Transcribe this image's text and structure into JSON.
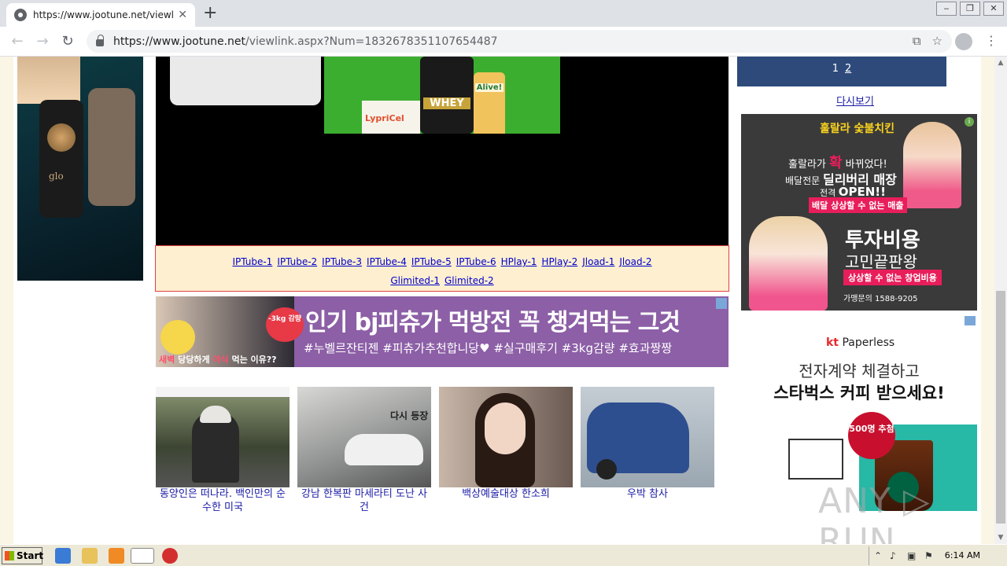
{
  "browser": {
    "tab_title": "https://www.jootune.net/viewlink.a",
    "tab_close": "✕",
    "new_tab": "+",
    "url_domain": "https://www.jootune.net",
    "url_path": "/viewlink.aspx?Num=1832678351107654487",
    "window_controls": [
      "‒",
      "❐",
      "✕"
    ]
  },
  "video_ad": {
    "product_label": "WHEY",
    "bottle_label": "Alive!",
    "box_label": "LypriCel"
  },
  "mirrors": {
    "row1": [
      "IPTube-1",
      "IPTube-2",
      "IPTube-3",
      "IPTube-4",
      "IPTube-5",
      "IPTube-6",
      "HPlay-1",
      "HPlay-2",
      "Jload-1",
      "Jload-2"
    ],
    "row2": [
      "Glimited-1",
      "Glimited-2"
    ]
  },
  "banner": {
    "headline": "인기 bj피츄가 먹방전 꼭 챙겨먹는 그것",
    "tags": "#누벨르잔티젠 #피츄가추천합니당♥ #실구매후기 #3kg감량 #효과짱짱",
    "badge": "-3kg 감량",
    "foot_red": "새벽",
    "foot_text": " 당당하게 ",
    "foot_red2": "야식",
    "foot_text2": " 먹는 이유??"
  },
  "thumbnails": [
    {
      "caption": "동양인은 떠나라. 백인만의 순수한 미국"
    },
    {
      "caption": "강남 한복판 마세라티 도난 사건",
      "overlay": "다시 등장"
    },
    {
      "caption": "백상예술대상 한소희"
    },
    {
      "caption": "우박 참사"
    }
  ],
  "pager": {
    "current": "1",
    "next": "2"
  },
  "replay": "다시보기",
  "ad_chicken": {
    "brand": "훌랄라 숯불치킨",
    "line1_pre": "훌랄라가 ",
    "line1_big": "확",
    "line1_post": " 바뀌었다!",
    "line2_pre": "배달전문 ",
    "line2_bold": "딜리버리 매장",
    "line3_pre": "전격 ",
    "line3_bold": "OPEN!!",
    "pill": "배달 상상할 수 없는 매출",
    "big1": "투자비용",
    "big2": "고민끝판왕",
    "pill2": "상상할 수 없는 창업비용",
    "phone": "가맹문의 1588-9205",
    "info": "i"
  },
  "ad_kt": {
    "logo_kt": "kt",
    "logo_rest": " Paperless",
    "line1": "전자계약 체결하고",
    "line2": "스타벅스 커피 받으세요!",
    "badge": "500명 추첨"
  },
  "left_ad": {
    "brand": "glo"
  },
  "watermark": "ANY ▷ RUN",
  "taskbar": {
    "start": "Start",
    "clock": "6:14 AM"
  }
}
